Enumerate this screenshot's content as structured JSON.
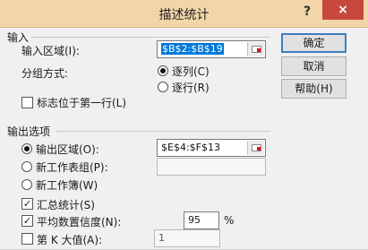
{
  "window": {
    "title": "描述统计",
    "help_glyph": "?",
    "close_glyph": "×"
  },
  "input": {
    "section_label": "输入",
    "range_label": "输入区域(I):",
    "range_value": "$B$2:$B$19",
    "group_label": "分组方式:",
    "group_by_column": "逐列(C)",
    "group_by_row": "逐行(R)",
    "labels_first_row": "标志位于第一行(L)"
  },
  "buttons": {
    "ok": "确定",
    "cancel": "取消",
    "help": "帮助(H)"
  },
  "output": {
    "section_label": "输出选项",
    "range_label": "输出区域(O):",
    "range_value": "$E$4:$F$13",
    "new_sheet_label": "新工作表组(P):",
    "new_sheet_value": "",
    "new_workbook_label": "新工作簿(W)",
    "summary_stats_label": "汇总统计(S)",
    "confidence_label": "平均数置信度(N):",
    "confidence_value": "95",
    "confidence_unit": "%",
    "kth_largest_label": "第 K 大值(A):",
    "kth_largest_value": "1"
  }
}
